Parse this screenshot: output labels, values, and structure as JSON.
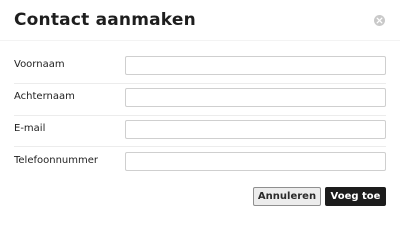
{
  "dialog": {
    "title": "Contact aanmaken",
    "close_icon": "close-icon"
  },
  "form": {
    "fields": [
      {
        "label": "Voornaam",
        "value": "",
        "placeholder": ""
      },
      {
        "label": "Achternaam",
        "value": "",
        "placeholder": ""
      },
      {
        "label": "E-mail",
        "value": "",
        "placeholder": ""
      },
      {
        "label": "Telefoonnummer",
        "value": "",
        "placeholder": ""
      }
    ]
  },
  "actions": {
    "cancel_label": "Annuleren",
    "submit_label": "Voeg toe"
  },
  "colors": {
    "primary_button": "#1c1c1c",
    "close_icon_bg": "#c9c9c9"
  }
}
